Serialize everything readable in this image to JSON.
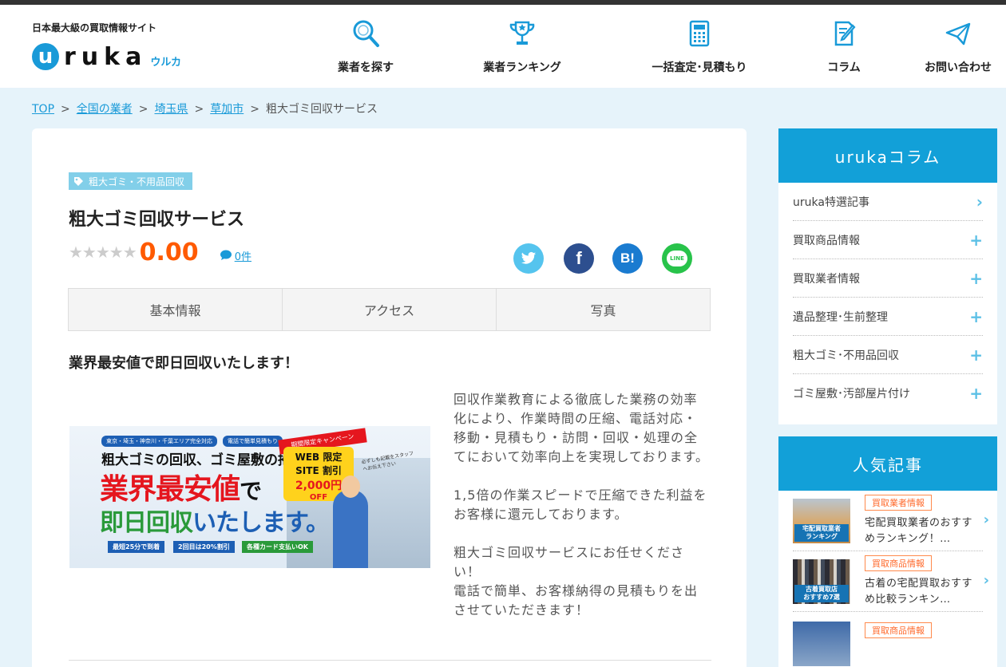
{
  "header": {
    "tagline": "日本最大級の買取情報サイト",
    "logo_initial": "u",
    "logo_rest": "ruka",
    "logo_kana": "ウルカ",
    "nav": [
      {
        "label": "業者を探す",
        "icon": "search-icon"
      },
      {
        "label": "業者ランキング",
        "icon": "trophy-icon"
      },
      {
        "label": "一括査定･見積もり",
        "icon": "calculator-icon"
      },
      {
        "label": "コラム",
        "icon": "note-pen-icon"
      },
      {
        "label": "お問い合わせ",
        "icon": "paper-plane-icon"
      }
    ]
  },
  "breadcrumb": {
    "items": [
      "TOP",
      "全国の業者",
      "埼玉県",
      "草加市"
    ],
    "current": "粗大ゴミ回収サービス",
    "separator": ">"
  },
  "main": {
    "category": "粗大ゴミ・不用品回収",
    "title": "粗大ゴミ回収サービス",
    "stars": "★★★★★",
    "rating": "0.00",
    "review_count": "0件",
    "share": {
      "twitter": "twitter-icon",
      "facebook": "f",
      "hatena": "B!",
      "line": "LINE"
    },
    "tabs": [
      "基本情報",
      "アクセス",
      "写真"
    ],
    "headline": "業界最安値で即日回収いたします！",
    "banner": {
      "tag1": "東京・埼玉・神奈川・千葉エリア完全対応",
      "tag2": "電話で簡単見積もり",
      "line1": "粗大ゴミの回収、ゴミ屋敷の掃除",
      "line2a": "業界最安値",
      "line2b": "で",
      "line3a": "即日回収",
      "line3b": "いたします。",
      "campaign": "期間限定キャンペーン",
      "web1": "WEB 限定",
      "web2": "SITE 割引",
      "price": "2,000円",
      "off": "OFF",
      "note": "必ずしも記載をスタッフへお伝え下さい",
      "feat1": "最短25分で到着",
      "feat2": "2回目は20%割引",
      "feat3": "各種カード支払いOK"
    },
    "paragraphs": [
      "回収作業教育による徹底した業務の効率化により、作業時間の圧縮、電話対応・移動・見積もり・訪問・回収・処理の全てにおいて効率向上を実現しております。",
      "1,5倍の作業スピードで圧縮できた利益をお客様に還元しております。",
      "粗大ゴミ回収サービスにお任せください！\n電話で簡単、お客様納得の見積もりを出させていただきます！"
    ]
  },
  "sidebar": {
    "column_title": "urukaコラム",
    "column_items": [
      {
        "label": "uruka特選記事",
        "icon": ">"
      },
      {
        "label": "買取商品情報",
        "icon": "+"
      },
      {
        "label": "買取業者情報",
        "icon": "+"
      },
      {
        "label": "遺品整理･生前整理",
        "icon": "+"
      },
      {
        "label": "粗大ゴミ･不用品回収",
        "icon": "+"
      },
      {
        "label": "ゴミ屋敷･汚部屋片付け",
        "icon": "+"
      }
    ],
    "popular_title": "人気記事",
    "articles": [
      {
        "badge": "買取業者情報",
        "title": "宅配買取業者のおすすめランキング！…",
        "thumb_label": "宅配買取業者\nランキング"
      },
      {
        "badge": "買取商品情報",
        "title": "古着の宅配買取おすすめ比較ランキン…",
        "thumb_label": "古着買取店\nおすすめ7選"
      },
      {
        "badge": "買取商品情報",
        "title": "",
        "thumb_label": ""
      }
    ]
  }
}
